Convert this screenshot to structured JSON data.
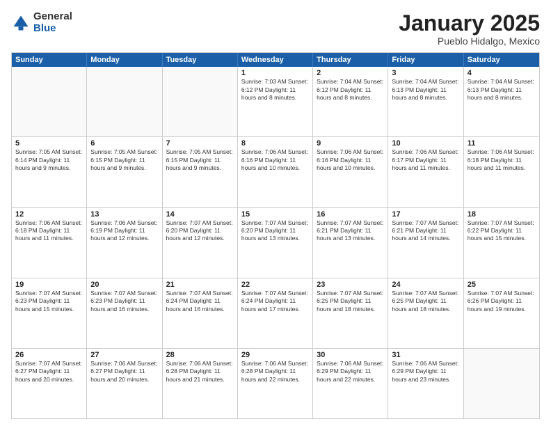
{
  "header": {
    "logo_general": "General",
    "logo_blue": "Blue",
    "title": "January 2025",
    "location": "Pueblo Hidalgo, Mexico"
  },
  "days_of_week": [
    "Sunday",
    "Monday",
    "Tuesday",
    "Wednesday",
    "Thursday",
    "Friday",
    "Saturday"
  ],
  "weeks": [
    [
      {
        "day": "",
        "info": ""
      },
      {
        "day": "",
        "info": ""
      },
      {
        "day": "",
        "info": ""
      },
      {
        "day": "1",
        "info": "Sunrise: 7:03 AM\nSunset: 6:12 PM\nDaylight: 11 hours\nand 8 minutes."
      },
      {
        "day": "2",
        "info": "Sunrise: 7:04 AM\nSunset: 6:12 PM\nDaylight: 11 hours\nand 8 minutes."
      },
      {
        "day": "3",
        "info": "Sunrise: 7:04 AM\nSunset: 6:13 PM\nDaylight: 11 hours\nand 8 minutes."
      },
      {
        "day": "4",
        "info": "Sunrise: 7:04 AM\nSunset: 6:13 PM\nDaylight: 11 hours\nand 8 minutes."
      }
    ],
    [
      {
        "day": "5",
        "info": "Sunrise: 7:05 AM\nSunset: 6:14 PM\nDaylight: 11 hours\nand 9 minutes."
      },
      {
        "day": "6",
        "info": "Sunrise: 7:05 AM\nSunset: 6:15 PM\nDaylight: 11 hours\nand 9 minutes."
      },
      {
        "day": "7",
        "info": "Sunrise: 7:05 AM\nSunset: 6:15 PM\nDaylight: 11 hours\nand 9 minutes."
      },
      {
        "day": "8",
        "info": "Sunrise: 7:06 AM\nSunset: 6:16 PM\nDaylight: 11 hours\nand 10 minutes."
      },
      {
        "day": "9",
        "info": "Sunrise: 7:06 AM\nSunset: 6:16 PM\nDaylight: 11 hours\nand 10 minutes."
      },
      {
        "day": "10",
        "info": "Sunrise: 7:06 AM\nSunset: 6:17 PM\nDaylight: 11 hours\nand 11 minutes."
      },
      {
        "day": "11",
        "info": "Sunrise: 7:06 AM\nSunset: 6:18 PM\nDaylight: 11 hours\nand 11 minutes."
      }
    ],
    [
      {
        "day": "12",
        "info": "Sunrise: 7:06 AM\nSunset: 6:18 PM\nDaylight: 11 hours\nand 11 minutes."
      },
      {
        "day": "13",
        "info": "Sunrise: 7:06 AM\nSunset: 6:19 PM\nDaylight: 11 hours\nand 12 minutes."
      },
      {
        "day": "14",
        "info": "Sunrise: 7:07 AM\nSunset: 6:20 PM\nDaylight: 11 hours\nand 12 minutes."
      },
      {
        "day": "15",
        "info": "Sunrise: 7:07 AM\nSunset: 6:20 PM\nDaylight: 11 hours\nand 13 minutes."
      },
      {
        "day": "16",
        "info": "Sunrise: 7:07 AM\nSunset: 6:21 PM\nDaylight: 11 hours\nand 13 minutes."
      },
      {
        "day": "17",
        "info": "Sunrise: 7:07 AM\nSunset: 6:21 PM\nDaylight: 11 hours\nand 14 minutes."
      },
      {
        "day": "18",
        "info": "Sunrise: 7:07 AM\nSunset: 6:22 PM\nDaylight: 11 hours\nand 15 minutes."
      }
    ],
    [
      {
        "day": "19",
        "info": "Sunrise: 7:07 AM\nSunset: 6:23 PM\nDaylight: 11 hours\nand 15 minutes."
      },
      {
        "day": "20",
        "info": "Sunrise: 7:07 AM\nSunset: 6:23 PM\nDaylight: 11 hours\nand 16 minutes."
      },
      {
        "day": "21",
        "info": "Sunrise: 7:07 AM\nSunset: 6:24 PM\nDaylight: 11 hours\nand 16 minutes."
      },
      {
        "day": "22",
        "info": "Sunrise: 7:07 AM\nSunset: 6:24 PM\nDaylight: 11 hours\nand 17 minutes."
      },
      {
        "day": "23",
        "info": "Sunrise: 7:07 AM\nSunset: 6:25 PM\nDaylight: 11 hours\nand 18 minutes."
      },
      {
        "day": "24",
        "info": "Sunrise: 7:07 AM\nSunset: 6:25 PM\nDaylight: 11 hours\nand 18 minutes."
      },
      {
        "day": "25",
        "info": "Sunrise: 7:07 AM\nSunset: 6:26 PM\nDaylight: 11 hours\nand 19 minutes."
      }
    ],
    [
      {
        "day": "26",
        "info": "Sunrise: 7:07 AM\nSunset: 6:27 PM\nDaylight: 11 hours\nand 20 minutes."
      },
      {
        "day": "27",
        "info": "Sunrise: 7:06 AM\nSunset: 6:27 PM\nDaylight: 11 hours\nand 20 minutes."
      },
      {
        "day": "28",
        "info": "Sunrise: 7:06 AM\nSunset: 6:28 PM\nDaylight: 11 hours\nand 21 minutes."
      },
      {
        "day": "29",
        "info": "Sunrise: 7:06 AM\nSunset: 6:28 PM\nDaylight: 11 hours\nand 22 minutes."
      },
      {
        "day": "30",
        "info": "Sunrise: 7:06 AM\nSunset: 6:29 PM\nDaylight: 11 hours\nand 22 minutes."
      },
      {
        "day": "31",
        "info": "Sunrise: 7:06 AM\nSunset: 6:29 PM\nDaylight: 11 hours\nand 23 minutes."
      },
      {
        "day": "",
        "info": ""
      }
    ]
  ]
}
